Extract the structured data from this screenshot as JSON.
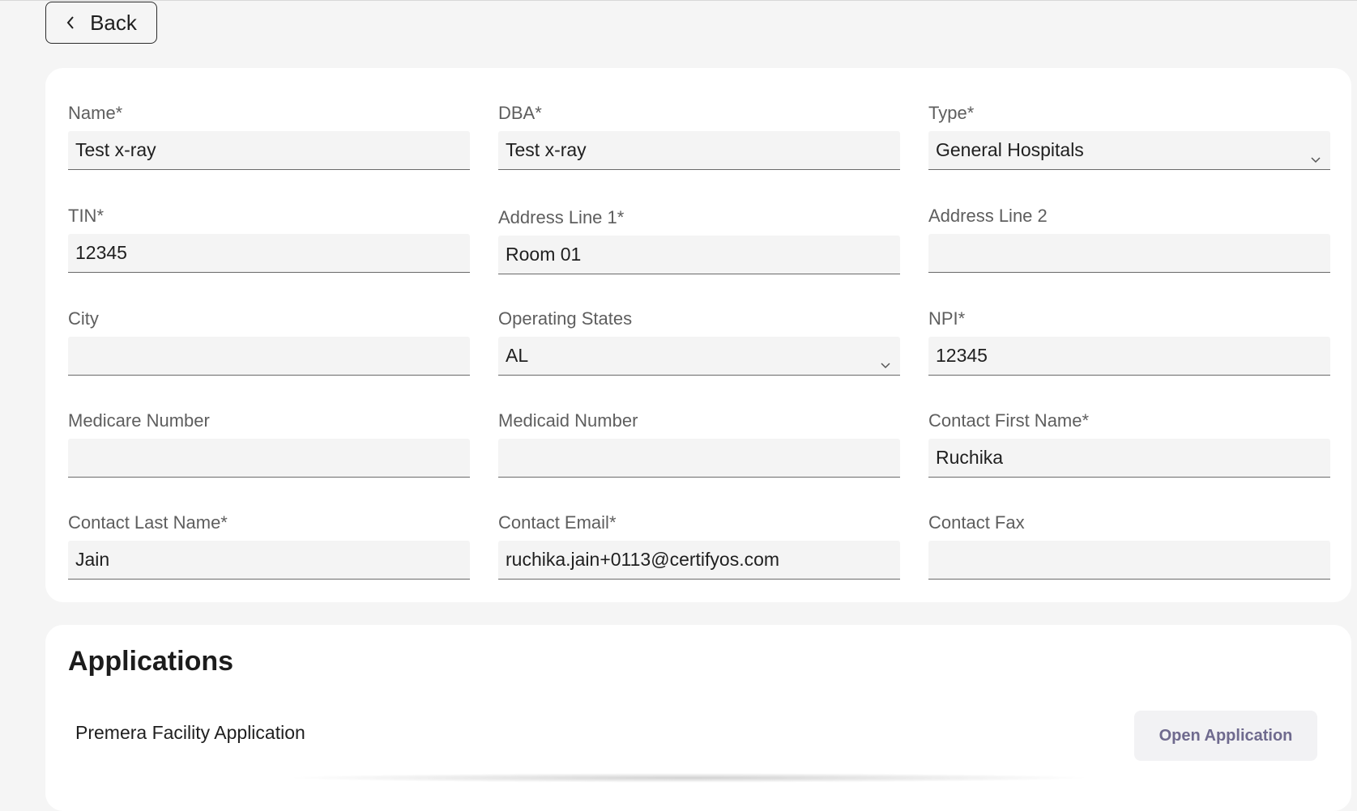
{
  "header": {
    "back_label": "Back"
  },
  "form": {
    "name": {
      "label": "Name*",
      "value": "Test x-ray"
    },
    "dba": {
      "label": "DBA*",
      "value": "Test x-ray"
    },
    "type": {
      "label": "Type*",
      "value": "General Hospitals"
    },
    "tin": {
      "label": "TIN*",
      "value": "12345"
    },
    "address_line_1": {
      "label": "Address Line 1*",
      "value": "Room 01"
    },
    "address_line_2": {
      "label": "Address Line 2",
      "value": ""
    },
    "city": {
      "label": "City",
      "value": ""
    },
    "operating_states": {
      "label": "Operating States",
      "value": "AL"
    },
    "npi": {
      "label": "NPI*",
      "value": "12345"
    },
    "medicare_number": {
      "label": "Medicare Number",
      "value": ""
    },
    "medicaid_number": {
      "label": "Medicaid Number",
      "value": ""
    },
    "contact_first_name": {
      "label": "Contact First Name*",
      "value": "Ruchika"
    },
    "contact_last_name": {
      "label": "Contact Last Name*",
      "value": "Jain"
    },
    "contact_email": {
      "label": "Contact Email*",
      "value": "ruchika.jain+0113@certifyos.com"
    },
    "contact_fax": {
      "label": "Contact Fax",
      "value": ""
    }
  },
  "applications": {
    "title": "Applications",
    "items": [
      {
        "name": "Premera Facility Application",
        "action_label": "Open Application"
      }
    ]
  },
  "icons": {
    "back": "chevron-left-icon",
    "dropdown": "chevron-down-icon"
  },
  "colors": {
    "background": "#f5f5f5",
    "card": "#ffffff",
    "field_fill": "#f4f4f4",
    "action_text": "#6f6a8e"
  }
}
